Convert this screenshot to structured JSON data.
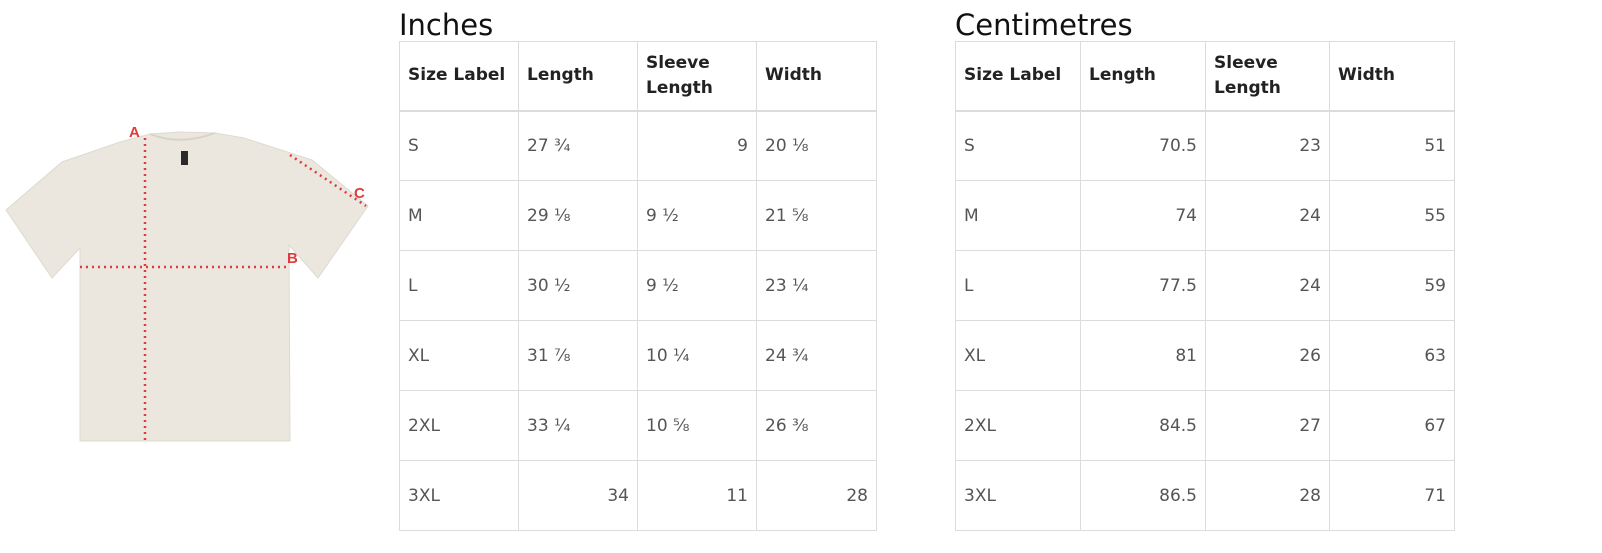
{
  "inches": {
    "title": "Inches",
    "headers": [
      "Size Label",
      "Length",
      "Sleeve Length",
      "Width"
    ],
    "rows": [
      [
        "S",
        "27 ¾",
        "9",
        "20 ⅛"
      ],
      [
        "M",
        "29 ⅛",
        "9 ½",
        "21 ⅝"
      ],
      [
        "L",
        "30 ½",
        "9 ½",
        "23 ¼"
      ],
      [
        "XL",
        "31 ⅞",
        "10 ¼",
        "24 ¾"
      ],
      [
        "2XL",
        "33 ¼",
        "10 ⅝",
        "26 ⅜"
      ],
      [
        "3XL",
        "34",
        "11",
        "28"
      ]
    ]
  },
  "centimetres": {
    "title": "Centimetres",
    "headers": [
      "Size Label",
      "Length",
      "Sleeve Length",
      "Width"
    ],
    "rows": [
      [
        "S",
        "70.5",
        "23",
        "51"
      ],
      [
        "M",
        "74",
        "24",
        "55"
      ],
      [
        "L",
        "77.5",
        "24",
        "59"
      ],
      [
        "XL",
        "81",
        "26",
        "63"
      ],
      [
        "2XL",
        "84.5",
        "27",
        "67"
      ],
      [
        "3XL",
        "86.5",
        "28",
        "71"
      ]
    ]
  },
  "diagram": {
    "label_a": "A",
    "label_b": "B",
    "label_c": "C",
    "shirt_color": "#ebe7df",
    "marker_color": "#e03a3a"
  }
}
